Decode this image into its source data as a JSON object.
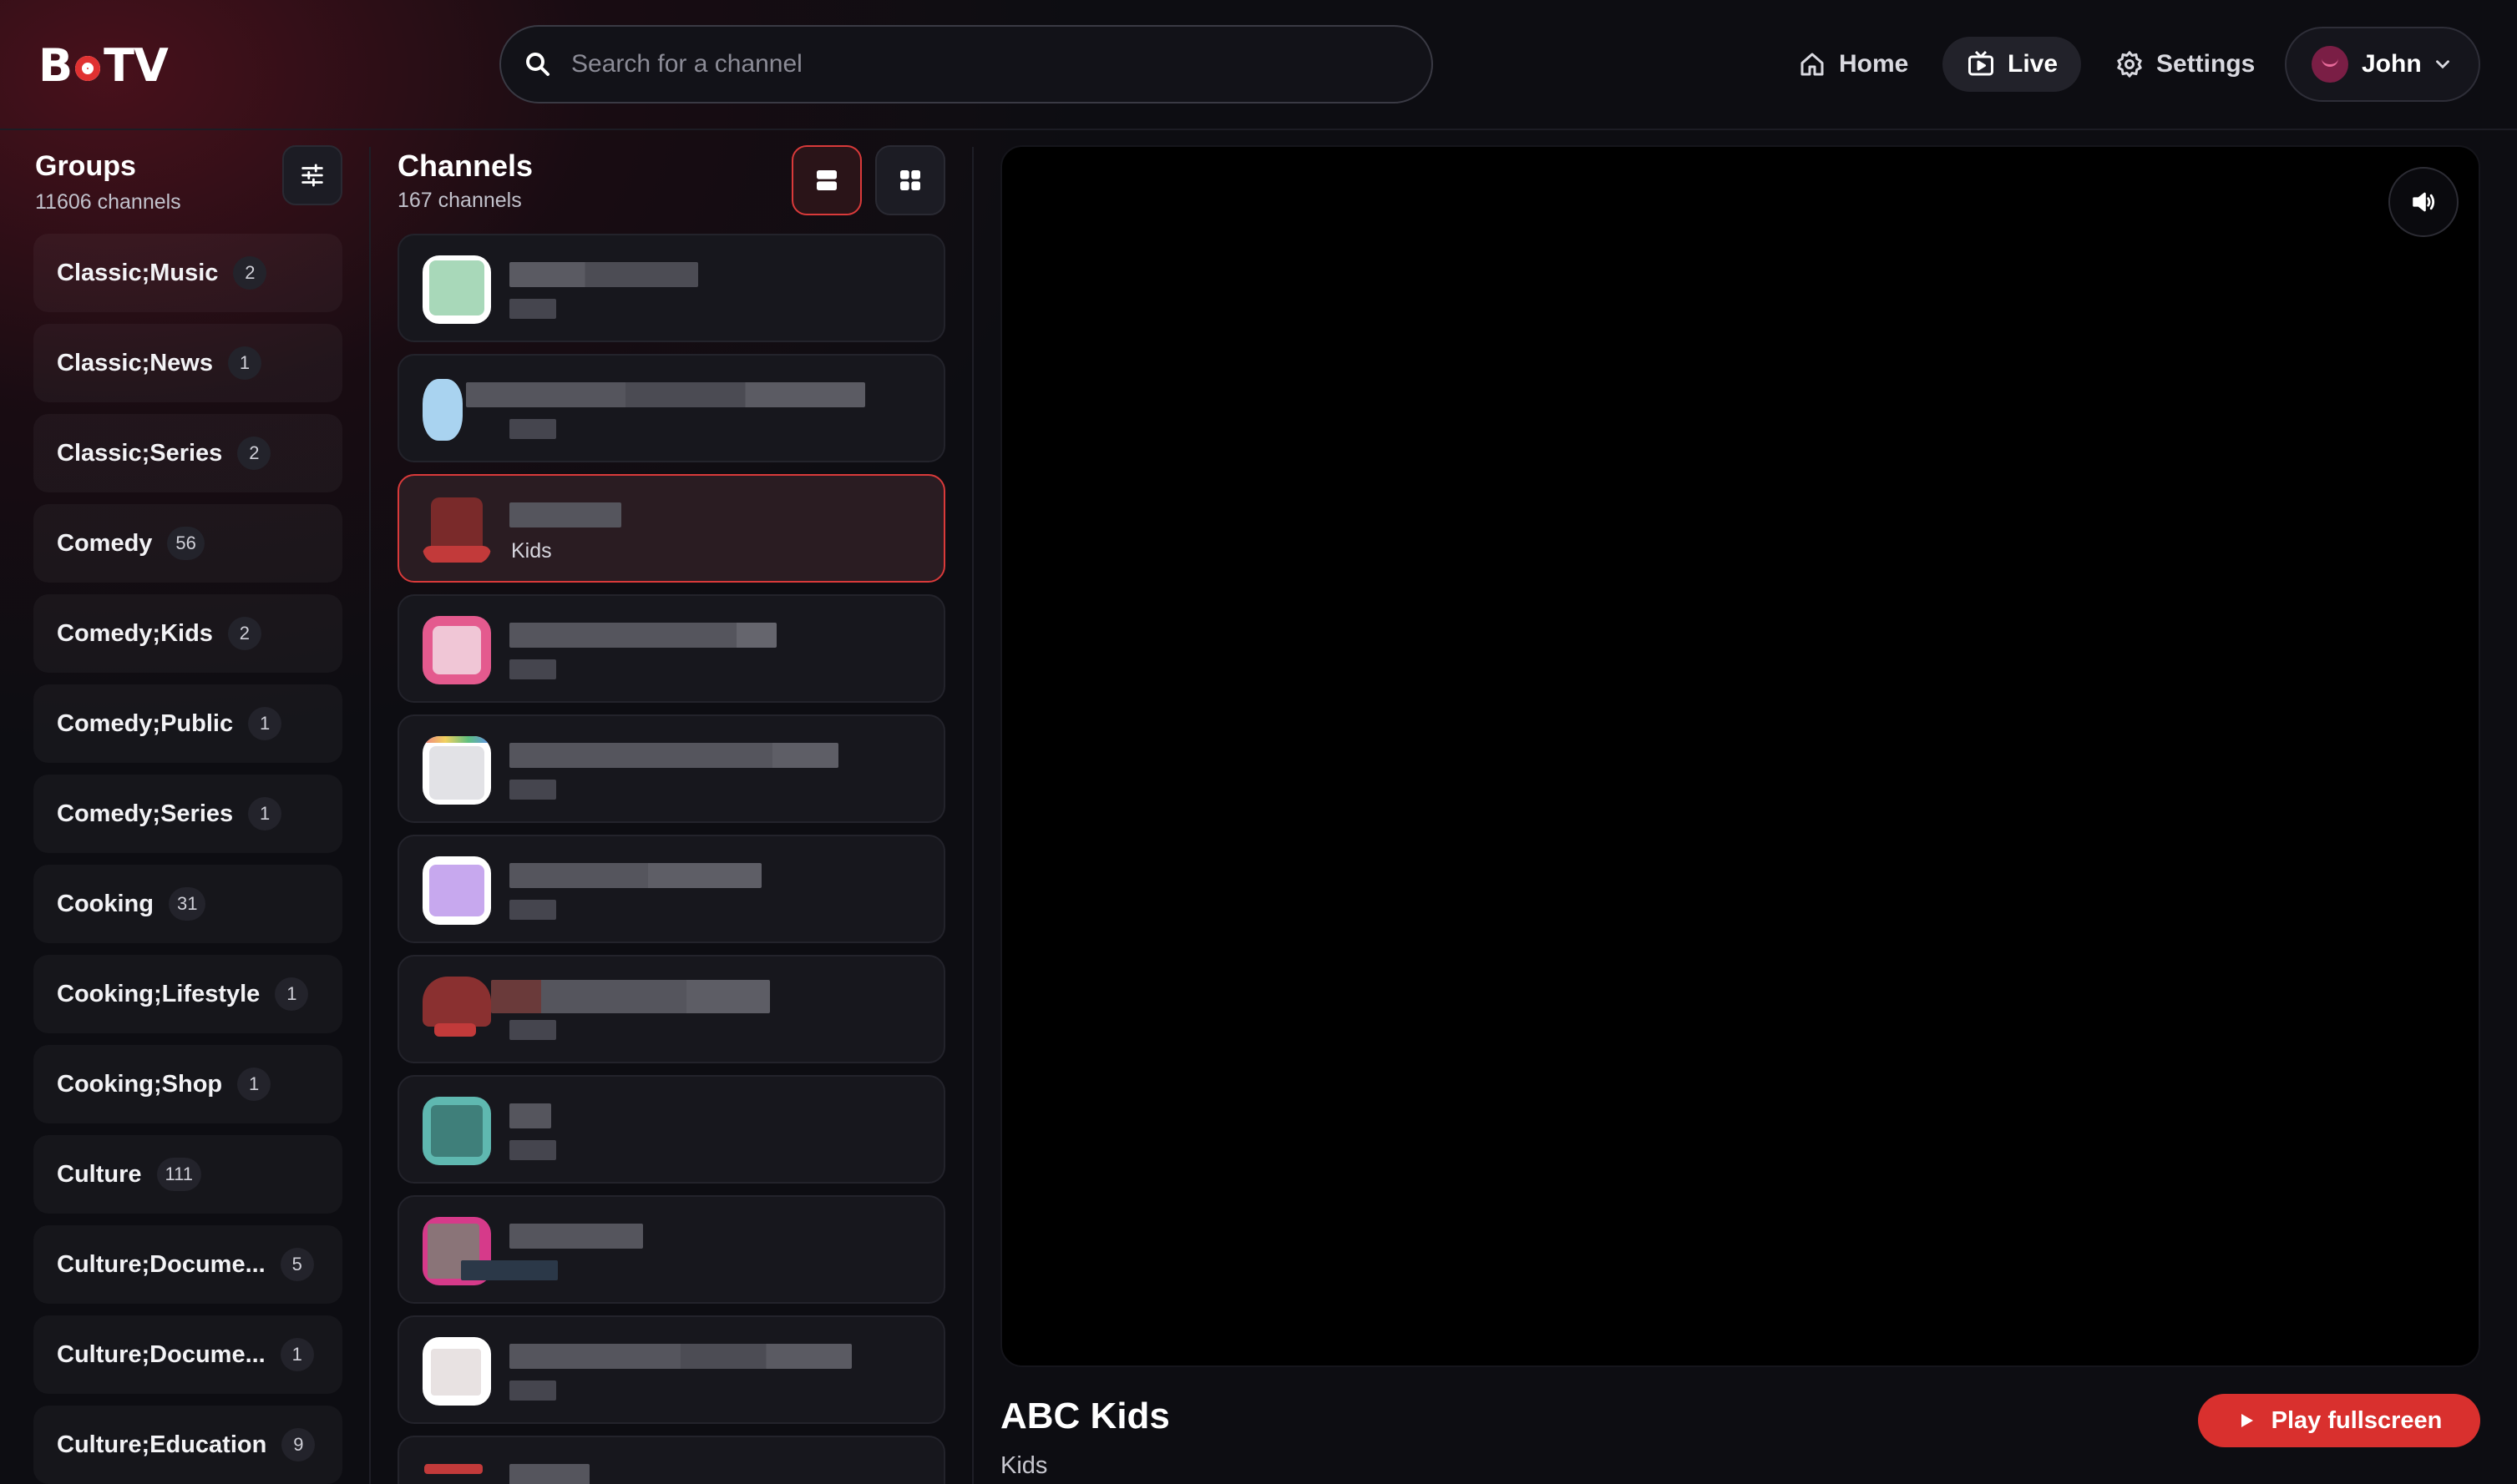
{
  "app": {
    "logo_text_left": "B",
    "logo_text_right": "TV"
  },
  "search": {
    "placeholder": "Search for a channel"
  },
  "nav": {
    "home": "Home",
    "live": "Live",
    "settings": "Settings"
  },
  "user": {
    "name": "John"
  },
  "groups": {
    "title": "Groups",
    "count_label": "11606 channels",
    "items": [
      {
        "label": "Classic;Music",
        "count": "2"
      },
      {
        "label": "Classic;News",
        "count": "1"
      },
      {
        "label": "Classic;Series",
        "count": "2"
      },
      {
        "label": "Comedy",
        "count": "56"
      },
      {
        "label": "Comedy;Kids",
        "count": "2"
      },
      {
        "label": "Comedy;Public",
        "count": "1"
      },
      {
        "label": "Comedy;Series",
        "count": "1"
      },
      {
        "label": "Cooking",
        "count": "31"
      },
      {
        "label": "Cooking;Lifestyle",
        "count": "1"
      },
      {
        "label": "Cooking;Shop",
        "count": "1"
      },
      {
        "label": "Culture",
        "count": "111"
      },
      {
        "label": "Culture;Docume...",
        "count": "5"
      },
      {
        "label": "Culture;Docume...",
        "count": "1"
      },
      {
        "label": "Culture;Education",
        "count": "9"
      }
    ]
  },
  "channels": {
    "title": "Channels",
    "count_label": "167 channels",
    "active_group_label": "Kids",
    "colors": {
      "logo_1": "#a8d8b9",
      "logo_2": "#a9d3f0",
      "logo_3": "#7a2a2a",
      "logo_4": "#f2a6c3",
      "logo_5": "#e2e2e6",
      "logo_6": "#c7a8ee",
      "logo_7": "#8a3030",
      "logo_8": "#3f7f7a",
      "logo_9": "#8a7478",
      "logo_10": "#e8e2e2",
      "logo_11": "#c23a3a"
    }
  },
  "player": {
    "title": "ABC Kids",
    "group": "Kids",
    "play_label": "Play fullscreen"
  },
  "theme": {
    "accent": "#d9302e",
    "background": "#0d0d12"
  }
}
